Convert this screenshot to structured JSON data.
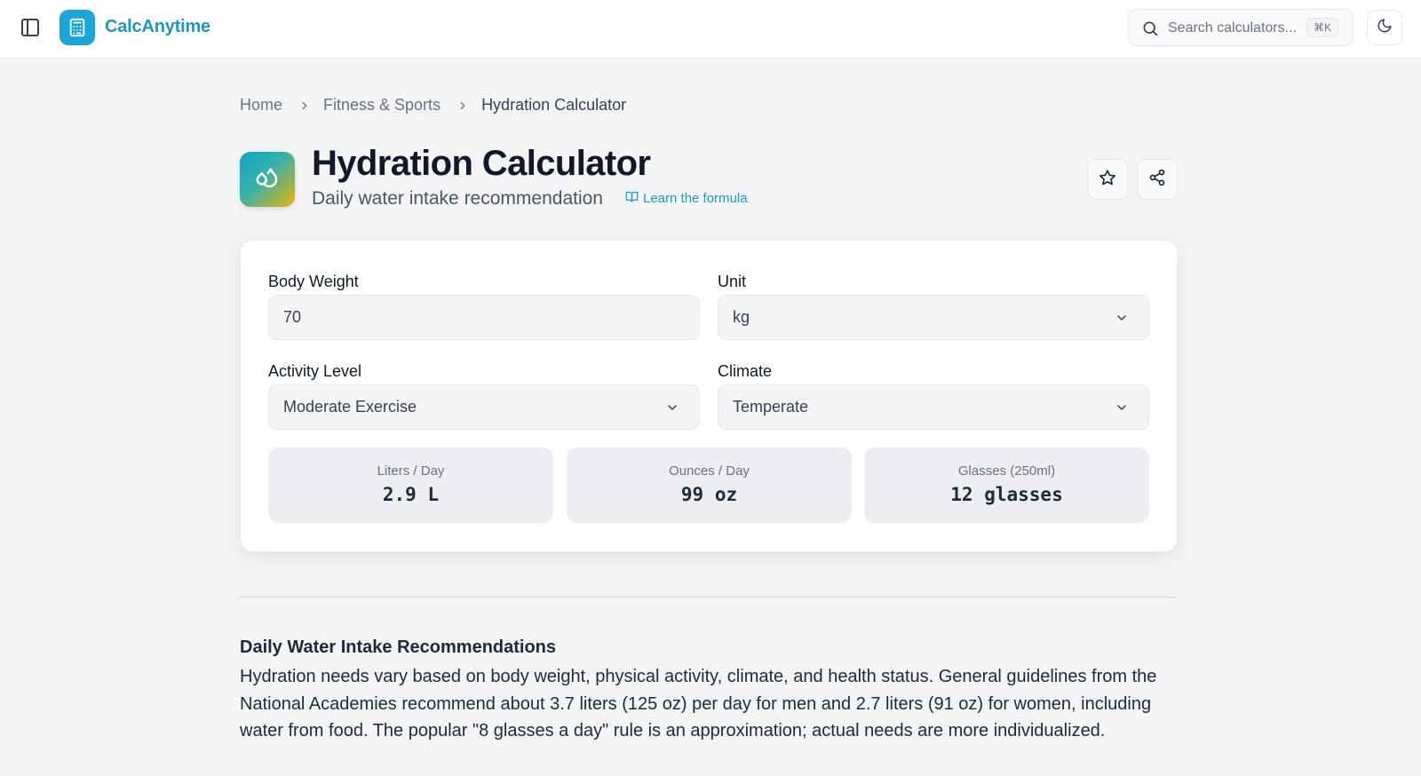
{
  "header": {
    "brand": "CalcAnytime",
    "search_placeholder": "Search calculators...",
    "search_shortcut": "⌘K",
    "accent": "#1aa6d8"
  },
  "breadcrumb": {
    "items": [
      "Home",
      "Fitness & Sports"
    ],
    "current": "Hydration Calculator"
  },
  "page": {
    "title": "Hydration Calculator",
    "subtitle": "Daily water intake recommendation",
    "formula_link": "Learn the formula"
  },
  "form": {
    "body_weight_label": "Body Weight",
    "body_weight_value": "70",
    "unit_label": "Unit",
    "unit_value": "kg",
    "activity_label": "Activity Level",
    "activity_value": "Moderate Exercise",
    "climate_label": "Climate",
    "climate_value": "Temperate"
  },
  "results": [
    {
      "label": "Liters / Day",
      "value": "2.9 L"
    },
    {
      "label": "Ounces / Day",
      "value": "99 oz"
    },
    {
      "label": "Glasses (250ml)",
      "value": "12 glasses"
    }
  ],
  "info": {
    "heading": "Daily Water Intake Recommendations",
    "paragraph": "Hydration needs vary based on body weight, physical activity, climate, and health status. General guidelines from the National Academies recommend about 3.7 liters (125 oz) per day for men and 2.7 liters (91 oz) for women, including water from food. The popular \"8 glasses a day\" rule is an approximation; actual needs are more individualized."
  },
  "icons": {
    "sidebar_toggle": "sidebar-toggle-icon",
    "logo": "calculator-icon",
    "search": "search-icon",
    "theme": "moon-icon",
    "chevron": "chevron-right-icon",
    "app": "droplets-icon",
    "formula": "book-open-icon",
    "favorite": "star-icon",
    "share": "share-icon",
    "dropdown": "chevron-down-icon"
  }
}
